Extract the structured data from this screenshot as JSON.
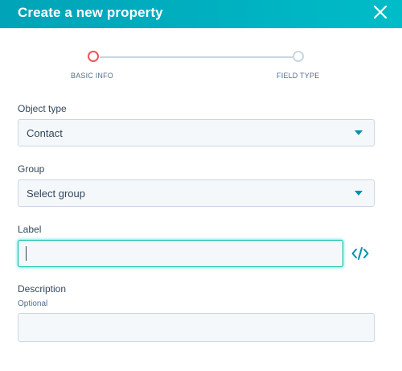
{
  "dialog": {
    "title": "Create a new property"
  },
  "stepper": {
    "steps": [
      {
        "label": "BASIC INFO",
        "state": "active"
      },
      {
        "label": "FIELD TYPE",
        "state": "inactive"
      }
    ]
  },
  "form": {
    "object_type": {
      "label": "Object type",
      "value": "Contact"
    },
    "group": {
      "label": "Group",
      "value": "Select group"
    },
    "label_field": {
      "label": "Label",
      "value": ""
    },
    "description": {
      "label": "Description",
      "hint": "Optional",
      "value": ""
    }
  },
  "icons": {
    "close": "close-icon",
    "code": "code-icon",
    "dropdown": "chevron-down-icon"
  },
  "colors": {
    "header_gradient_start": "#00a3b7",
    "header_gradient_end": "#00bcc8",
    "active_step": "#f2545b",
    "inactive_step": "#cbd6e2",
    "accent": "#0091ae",
    "focus_border": "#00bda5",
    "text": "#33475b"
  }
}
